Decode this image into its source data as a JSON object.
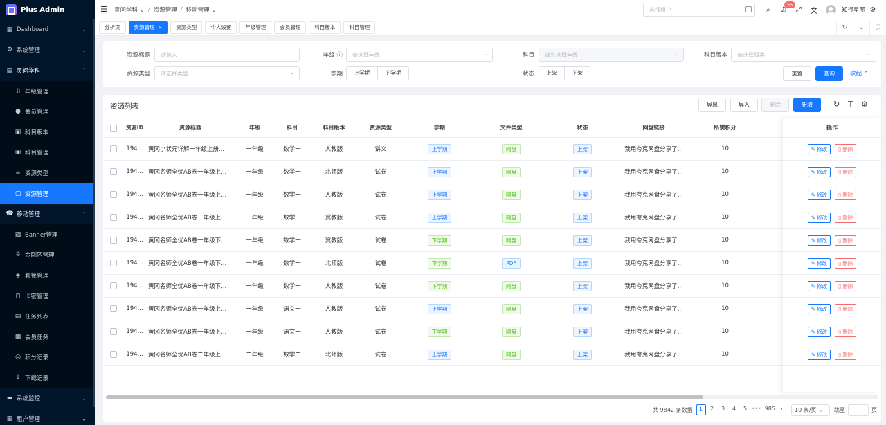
{
  "app": {
    "title": "Plus Admin"
  },
  "sidebar": {
    "items": [
      {
        "label": "Dashboard",
        "icon": "dashboard-icon",
        "glyph": "▦",
        "type": "group",
        "chevron": "⌄"
      },
      {
        "label": "系统管理",
        "icon": "settings-icon",
        "glyph": "⚙",
        "type": "group",
        "chevron": "⌄"
      },
      {
        "label": "灵问学科",
        "icon": "book-icon",
        "glyph": "▤",
        "type": "group-open",
        "chevron": "⌃"
      },
      {
        "label": "年级管理",
        "icon": "bell-icon",
        "glyph": "♫",
        "type": "sub"
      },
      {
        "label": "会员管理",
        "icon": "chat-icon",
        "glyph": "●",
        "type": "sub"
      },
      {
        "label": "科目版本",
        "icon": "document-icon",
        "glyph": "▣",
        "type": "sub"
      },
      {
        "label": "科目管理",
        "icon": "list-icon",
        "glyph": "▣",
        "type": "sub"
      },
      {
        "label": "资源类型",
        "icon": "link-icon",
        "glyph": "∞",
        "type": "sub"
      },
      {
        "label": "资源管理",
        "icon": "resource-icon",
        "glyph": "▢",
        "type": "sub-active"
      },
      {
        "label": "移动管理",
        "icon": "mobile-icon",
        "glyph": "☎",
        "type": "group-open",
        "chevron": "⌃"
      },
      {
        "label": "Banner管理",
        "icon": "image-icon",
        "glyph": "▨",
        "type": "sub"
      },
      {
        "label": "金刚区管理",
        "icon": "gear-icon",
        "glyph": "✲",
        "type": "sub"
      },
      {
        "label": "套餐管理",
        "icon": "package-icon",
        "glyph": "◈",
        "type": "sub"
      },
      {
        "label": "卡密管理",
        "icon": "lock-icon",
        "glyph": "⊓",
        "type": "sub"
      },
      {
        "label": "任务列表",
        "icon": "task-icon",
        "glyph": "▤",
        "type": "sub"
      },
      {
        "label": "会员任务",
        "icon": "member-task-icon",
        "glyph": "▦",
        "type": "sub"
      },
      {
        "label": "积分记录",
        "icon": "points-icon",
        "glyph": "◎",
        "type": "sub"
      },
      {
        "label": "下载记录",
        "icon": "download-icon",
        "glyph": "↓",
        "type": "sub"
      },
      {
        "label": "系统监控",
        "icon": "monitor-icon",
        "glyph": "▬",
        "type": "group",
        "chevron": "⌄"
      },
      {
        "label": "租户管理",
        "icon": "tenant-icon",
        "glyph": "▦",
        "type": "group",
        "chevron": "⌄"
      }
    ]
  },
  "header": {
    "breadcrumb": [
      "灵问学科",
      "资源管理",
      "移动管理"
    ],
    "tenant_placeholder": "选择租户",
    "notification_count": "55",
    "username": "知行星图"
  },
  "tabs": [
    {
      "label": "分析页",
      "active": false
    },
    {
      "label": "资源管理",
      "active": true
    },
    {
      "label": "资源类型",
      "active": false
    },
    {
      "label": "个人设置",
      "active": false
    },
    {
      "label": "年级管理",
      "active": false
    },
    {
      "label": "会员管理",
      "active": false
    },
    {
      "label": "科目版本",
      "active": false
    },
    {
      "label": "科目管理",
      "active": false
    }
  ],
  "filters": {
    "title_label": "资源标题",
    "title_placeholder": "请输入",
    "grade_label": "年级",
    "grade_placeholder": "请选择年级",
    "subject_label": "科目",
    "subject_placeholder": "请先选择年级",
    "version_label": "科目版本",
    "version_placeholder": "请选择版本",
    "type_label": "资源类型",
    "type_placeholder": "请选择类型",
    "term_label": "学期",
    "term_options": [
      "上学期",
      "下学期"
    ],
    "status_label": "状态",
    "status_options": [
      "上架",
      "下架"
    ],
    "reset": "重置",
    "query": "查询",
    "collapse": "收起"
  },
  "table": {
    "title": "资源列表",
    "actions": {
      "export": "导出",
      "import": "导入",
      "delete": "删除",
      "add": "新增"
    },
    "columns": [
      "资源ID",
      "资源标题",
      "年级",
      "科目",
      "科目版本",
      "资源类型",
      "学期",
      "文件类型",
      "状态",
      "网盘链接",
      "所需积分",
      "操作"
    ],
    "edit_label": "修改",
    "delete_label": "删除",
    "rows": [
      {
        "id": "194...",
        "title": "黄冈小状元详解一年级上册...",
        "grade": "一年级",
        "subject": "数学一",
        "version": "人教版",
        "type": "讲义",
        "term": "上学期",
        "file": "网盘",
        "status": "上架",
        "link": "我用夸克网盘分享了...",
        "points": "10"
      },
      {
        "id": "194...",
        "title": "黄冈名师全优AB卷一年级上...",
        "grade": "一年级",
        "subject": "数学一",
        "version": "北师版",
        "type": "试卷",
        "term": "上学期",
        "file": "网盘",
        "status": "上架",
        "link": "我用夸克网盘分享了...",
        "points": "10"
      },
      {
        "id": "194...",
        "title": "黄冈名师全优AB卷一年级上...",
        "grade": "一年级",
        "subject": "数学一",
        "version": "人教版",
        "type": "试卷",
        "term": "上学期",
        "file": "网盘",
        "status": "上架",
        "link": "我用夸克网盘分享了...",
        "points": "10"
      },
      {
        "id": "194...",
        "title": "黄冈名师全优AB卷一年级上...",
        "grade": "一年级",
        "subject": "数学一",
        "version": "冀教版",
        "type": "试卷",
        "term": "上学期",
        "file": "网盘",
        "status": "上架",
        "link": "我用夸克网盘分享了...",
        "points": "10"
      },
      {
        "id": "194...",
        "title": "黄冈名师全优AB卷一年级下...",
        "grade": "一年级",
        "subject": "数学一",
        "version": "冀教版",
        "type": "试卷",
        "term": "下学期",
        "file": "网盘",
        "status": "上架",
        "link": "我用夸克网盘分享了...",
        "points": "10"
      },
      {
        "id": "194...",
        "title": "黄冈名师全优AB卷一年级下...",
        "grade": "一年级",
        "subject": "数学一",
        "version": "北师版",
        "type": "试卷",
        "term": "下学期",
        "file": "PDF",
        "status": "上架",
        "link": "我用夸克网盘分享了...",
        "points": "10"
      },
      {
        "id": "194...",
        "title": "黄冈名师全优AB卷一年级下...",
        "grade": "一年级",
        "subject": "数学一",
        "version": "人教版",
        "type": "试卷",
        "term": "下学期",
        "file": "网盘",
        "status": "上架",
        "link": "我用夸克网盘分享了...",
        "points": "10"
      },
      {
        "id": "194...",
        "title": "黄冈名师全优AB卷一年级上...",
        "grade": "一年级",
        "subject": "语文一",
        "version": "人教版",
        "type": "试卷",
        "term": "上学期",
        "file": "网盘",
        "status": "上架",
        "link": "我用夸克网盘分享了...",
        "points": "10"
      },
      {
        "id": "194...",
        "title": "黄冈名师全优AB卷一年级下...",
        "grade": "一年级",
        "subject": "语文一",
        "version": "人教版",
        "type": "试卷",
        "term": "下学期",
        "file": "网盘",
        "status": "上架",
        "link": "我用夸克网盘分享了...",
        "points": "10"
      },
      {
        "id": "194...",
        "title": "黄冈名师全优AB卷二年级上...",
        "grade": "二年级",
        "subject": "数学二",
        "version": "北师版",
        "type": "试卷",
        "term": "上学期",
        "file": "网盘",
        "status": "上架",
        "link": "我用夸克网盘分享了...",
        "points": "10"
      }
    ]
  },
  "pagination": {
    "total_text": "共 9842 条数据",
    "pages": [
      "1",
      "2",
      "3",
      "4",
      "5"
    ],
    "ellipsis": "•••",
    "last_page": "985",
    "page_size": "10 条/页",
    "jump_label": "跳至",
    "page_suffix": "页"
  }
}
